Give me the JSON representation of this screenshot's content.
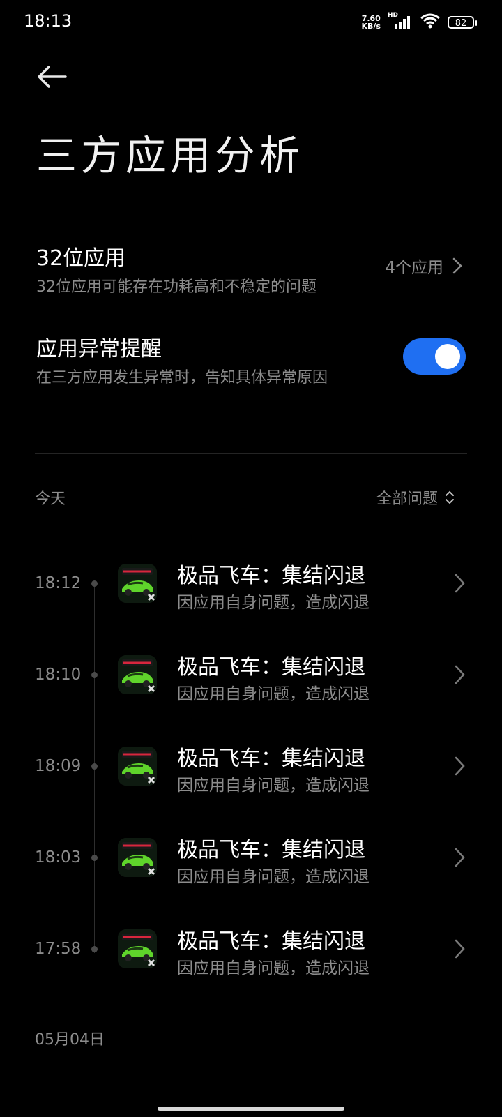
{
  "status_bar": {
    "time": "18:13",
    "net_speed_value": "7.60",
    "net_speed_unit": "KB/s",
    "network_badge": "HD",
    "battery": "82"
  },
  "header": {
    "title": "三方应用分析"
  },
  "settings": {
    "bit32": {
      "title": "32位应用",
      "subtitle": "32位应用可能存在功耗高和不稳定的问题",
      "count": "4个应用"
    },
    "alert": {
      "title": "应用异常提醒",
      "subtitle": "在三方应用发生异常时，告知具体异常原因",
      "enabled": true
    }
  },
  "list": {
    "today_label": "今天",
    "filter_label": "全部问题",
    "events": [
      {
        "time": "18:12",
        "title": "极品飞车：集结闪退",
        "subtitle": "因应用自身问题，造成闪退"
      },
      {
        "time": "18:10",
        "title": "极品飞车：集结闪退",
        "subtitle": "因应用自身问题，造成闪退"
      },
      {
        "time": "18:09",
        "title": "极品飞车：集结闪退",
        "subtitle": "因应用自身问题，造成闪退"
      },
      {
        "time": "18:03",
        "title": "极品飞车：集结闪退",
        "subtitle": "因应用自身问题，造成闪退"
      },
      {
        "time": "17:58",
        "title": "极品飞车：集结闪退",
        "subtitle": "因应用自身问题，造成闪退"
      }
    ],
    "next_date_label": "05月04日"
  },
  "colors": {
    "background": "#000000",
    "accent": "#1f6ff2",
    "secondary_text": "#8c8c8c"
  },
  "icons": {
    "back": "arrow-left-icon",
    "chevron": "chevron-right-icon",
    "sort": "sort-updown-icon",
    "app": "need-for-speed-app-icon"
  }
}
